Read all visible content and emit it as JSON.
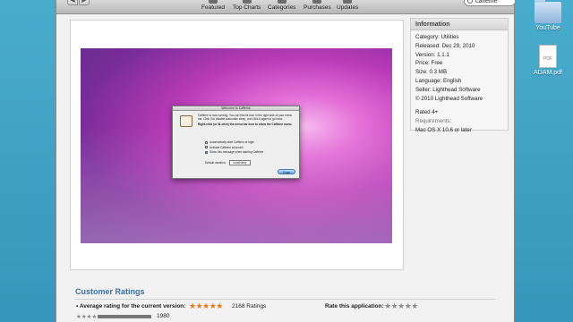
{
  "desktop": {
    "icons": [
      {
        "label": "YouTube",
        "icon": "folder-icon"
      },
      {
        "label": "ADAM.pdf",
        "icon": "pdf-file-icon",
        "badge": "PDF"
      }
    ]
  },
  "toolbar": {
    "back": "◀",
    "forward": "▶",
    "tabs": [
      "Featured",
      "Top Charts",
      "Categories",
      "Purchases",
      "Updates"
    ],
    "search_value": "caffeine"
  },
  "screenshot": {
    "dialog_title": "Welcome to Caffeine",
    "dialog_text": "Caffeine is now running. You can find its icon in the right side of your menu bar. Click it to disable automatic sleep, and click it again to go back.",
    "dialog_text2": "Right-click (or ⌘-click) the menu bar icon to show the Caffeine menu.",
    "checks": [
      {
        "label": "Automatically start Caffeine at login",
        "checked": false
      },
      {
        "label": "Activate Caffeine at launch",
        "checked": false
      },
      {
        "label": "Show this message when starting Caffeine",
        "checked": true
      }
    ],
    "duration_label": "Default duration:",
    "duration_value": "Indefinitely",
    "close_label": "Close"
  },
  "info": {
    "title": "Information",
    "category": "Category: Utilities",
    "released": "Released: Dec 29, 2010",
    "version": "Version: 1.1.1",
    "price": "Price: Free",
    "size": "Size: 0.3 MB",
    "language": "Language: English",
    "seller": "Seller: Lighthead Software",
    "copyright": "© 2010 Lighthead Software",
    "rated": "Rated 4+",
    "requirements_label": "Requirements:",
    "requirements": "Mac OS X 10.6 or later"
  },
  "ratings": {
    "title": "Customer Ratings",
    "average_label": "• Average rating for the current version:",
    "average_stars": 5,
    "count": "2168 Ratings",
    "rate_label": "Rate this application:",
    "five_star_count": "1980",
    "five_star_fraction": 0.91
  }
}
